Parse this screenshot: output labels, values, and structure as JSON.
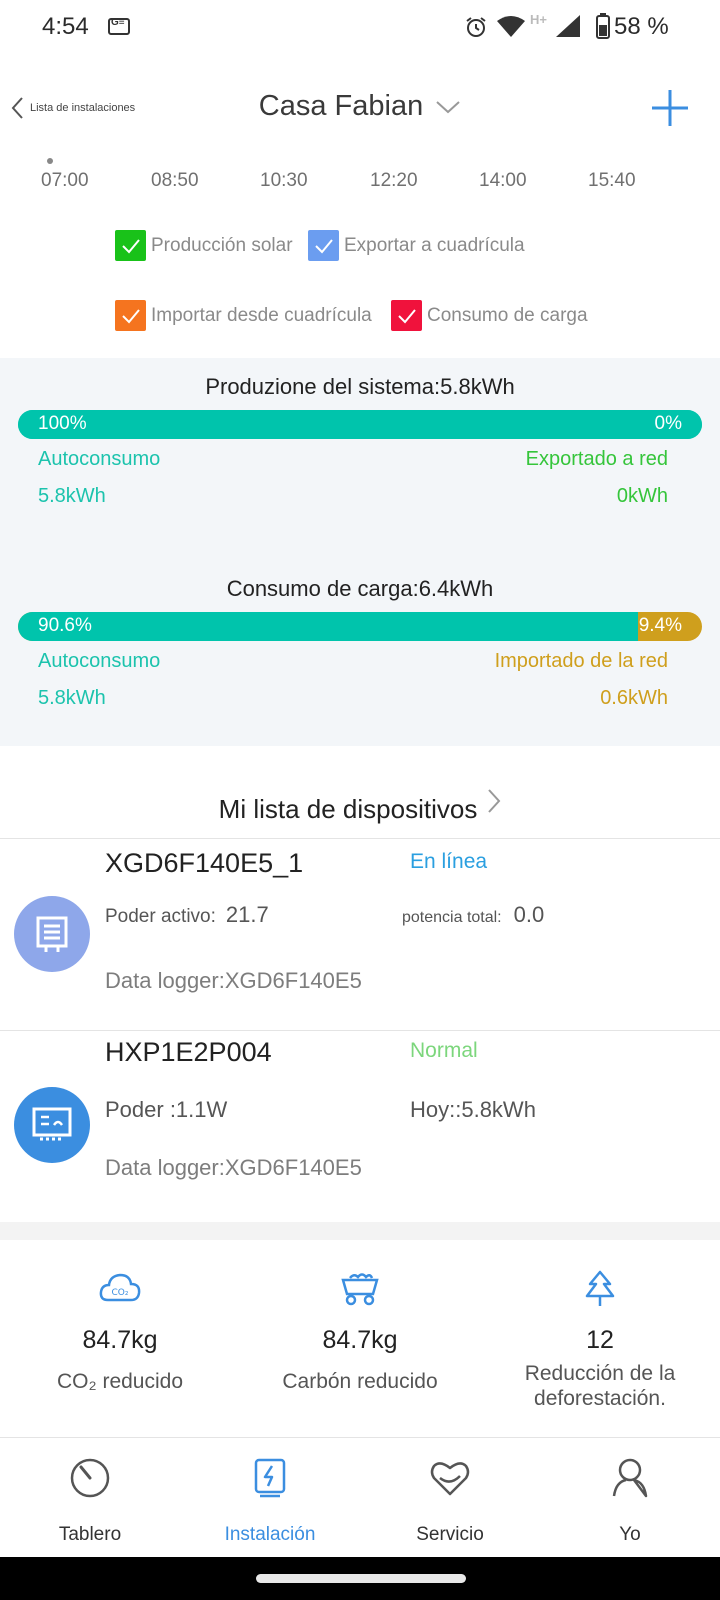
{
  "statusbar": {
    "time": "4:54",
    "network": "H+",
    "battery": "58 %"
  },
  "header": {
    "back_label": "Lista de instalaciones",
    "title": "Casa Fabian"
  },
  "time_axis": [
    "07:00",
    "08:50",
    "10:30",
    "12:20",
    "14:00",
    "15:40"
  ],
  "legend": [
    {
      "label": "Producción solar",
      "color": "#19c219"
    },
    {
      "label": "Exportar a cuadrícula",
      "color": "#6b9df0"
    },
    {
      "label": "Importar desde cuadrícula",
      "color": "#f5741f"
    },
    {
      "label": "Consumo de carga",
      "color": "#f0123c"
    }
  ],
  "production": {
    "title": "Produzione del sistema:5.8kWh",
    "self_pct": "100%",
    "export_pct": "0%",
    "self_fraction": 1.0,
    "self_label": "Autoconsumo",
    "export_label": "Exportado a red",
    "self_value": "5.8kWh",
    "export_value": "0kWh",
    "bar_color": "#00c4ac"
  },
  "consumption": {
    "title": "Consumo de carga:6.4kWh",
    "self_pct": "90.6%",
    "import_pct": "9.4%",
    "self_fraction": 0.906,
    "self_label": "Autoconsumo",
    "import_label": "Importado de la red",
    "self_value": "5.8kWh",
    "import_value": "0.6kWh",
    "bar_color": "#00c4ac",
    "import_color": "#cf9f1d"
  },
  "devices_header": "Mi lista de dispositivos",
  "devices": [
    {
      "name": "XGD6F140E5_1",
      "status": "En línea",
      "status_color": "#2a9fe0",
      "left_key": "Poder activo:",
      "left_value": "21.7",
      "right_key": "potencia total:",
      "right_value": "0.0",
      "logger": "Data logger:XGD6F140E5",
      "icon": "datalogger-icon"
    },
    {
      "name": "HXP1E2P004",
      "status": "Normal",
      "status_color": "#7cd67c",
      "left_text": "Poder :1.1W",
      "right_text": "Hoy::5.8kWh",
      "logger": "Data logger:XGD6F140E5",
      "icon": "inverter-icon"
    }
  ],
  "eco": [
    {
      "value": "84.7kg",
      "label": "CO₂ reducido",
      "icon": "co2-cloud-icon"
    },
    {
      "value": "84.7kg",
      "label": "Carbón reducido",
      "icon": "coal-cart-icon"
    },
    {
      "value": "12",
      "label_line1": "Reducción de la",
      "label_line2": "deforestación.",
      "icon": "tree-icon"
    }
  ],
  "nav": [
    {
      "label": "Tablero",
      "icon": "dashboard-icon"
    },
    {
      "label": "Instalación",
      "icon": "installation-icon",
      "active": true
    },
    {
      "label": "Servicio",
      "icon": "service-icon"
    },
    {
      "label": "Yo",
      "icon": "profile-icon"
    }
  ],
  "colors": {
    "accent": "#3b8ee0",
    "teal": "#1cc3ad",
    "export_green": "#35c53b",
    "import_gold": "#cf9f1d"
  }
}
